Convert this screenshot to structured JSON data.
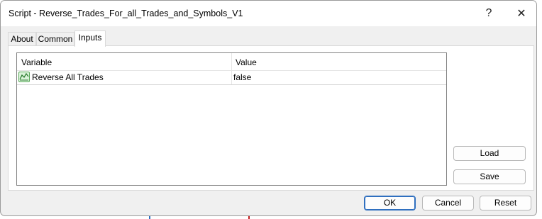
{
  "window": {
    "title": "Script - Reverse_Trades_For_all_Trades_and_Symbols_V1",
    "help_glyph": "?",
    "close_glyph": "✕"
  },
  "tabs": [
    {
      "label": "About",
      "active": false
    },
    {
      "label": "Common",
      "active": false
    },
    {
      "label": "Inputs",
      "active": true
    }
  ],
  "inputs_table": {
    "columns": [
      "Variable",
      "Value"
    ],
    "rows": [
      {
        "icon": "parameter-icon",
        "variable": "Reverse All Trades",
        "value": "false"
      }
    ]
  },
  "side_buttons": {
    "load": "Load",
    "save": "Save"
  },
  "footer_buttons": {
    "ok": "OK",
    "cancel": "Cancel",
    "reset": "Reset"
  },
  "colors": {
    "default_button_border": "#2f6fbf",
    "icon_green": "#5aa85a"
  }
}
